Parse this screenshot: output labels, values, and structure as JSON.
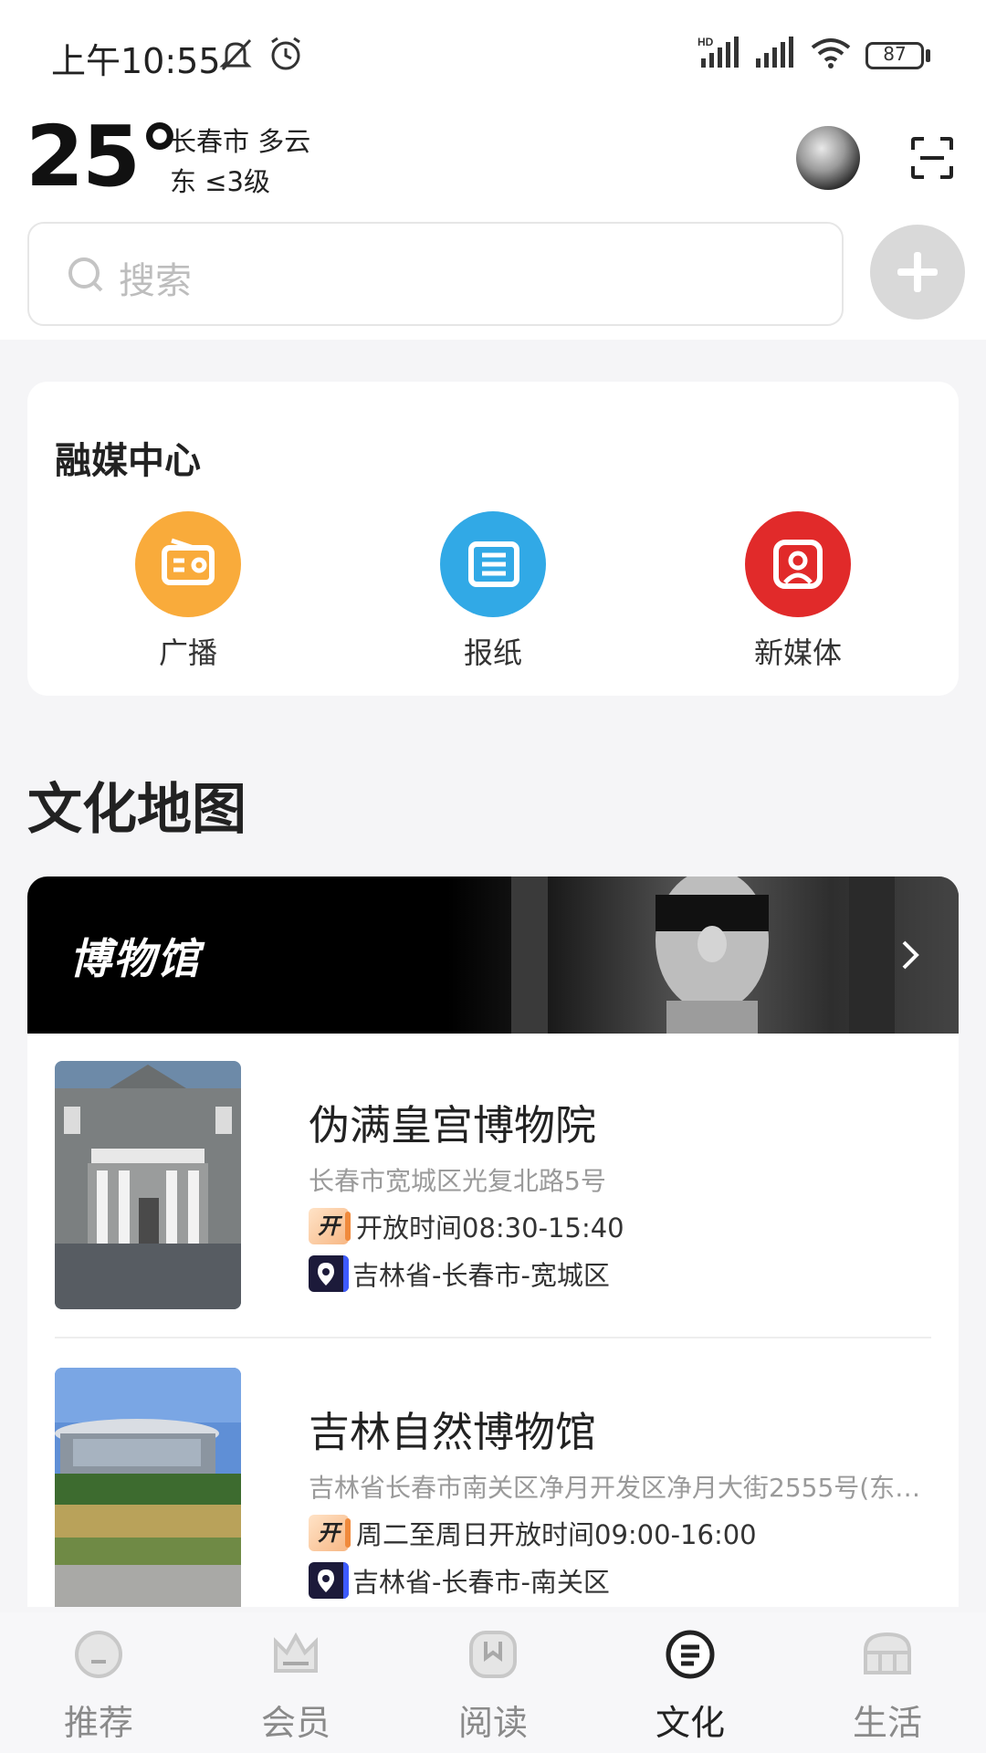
{
  "status_bar": {
    "time": "上午10:55",
    "battery": "87",
    "network_label": "HD"
  },
  "weather": {
    "temperature": "25°",
    "city_condition": "长春市 多云",
    "wind": "东 ≤3级"
  },
  "search": {
    "placeholder": "搜索"
  },
  "media_center": {
    "title": "融媒中心",
    "items": [
      {
        "label": "广播",
        "color": "#f9ab3b",
        "icon": "radio-icon"
      },
      {
        "label": "报纸",
        "color": "#31a9e6",
        "icon": "newspaper-icon"
      },
      {
        "label": "新媒体",
        "color": "#e12a2a",
        "icon": "new-media-icon"
      }
    ]
  },
  "culture_map": {
    "title": "文化地图",
    "banner_title": "博物馆",
    "places": [
      {
        "name": "伪满皇宫博物院",
        "address": "长春市宽城区光复北路5号",
        "open_tag": "开",
        "hours": "开放时间08:30-15:40",
        "region": "吉林省-长春市-宽城区"
      },
      {
        "name": "吉林自然博物馆",
        "address": "吉林省长春市南关区净月开发区净月大街2555号(东…",
        "open_tag": "开",
        "hours": "周二至周日开放时间09:00-16:00",
        "region": "吉林省-长春市-南关区"
      }
    ]
  },
  "tabs": [
    {
      "label": "推荐",
      "icon": "recommend-icon",
      "active": false
    },
    {
      "label": "会员",
      "icon": "crown-icon",
      "active": false
    },
    {
      "label": "阅读",
      "icon": "read-icon",
      "active": false
    },
    {
      "label": "文化",
      "icon": "culture-icon",
      "active": true
    },
    {
      "label": "生活",
      "icon": "life-icon",
      "active": false
    }
  ]
}
